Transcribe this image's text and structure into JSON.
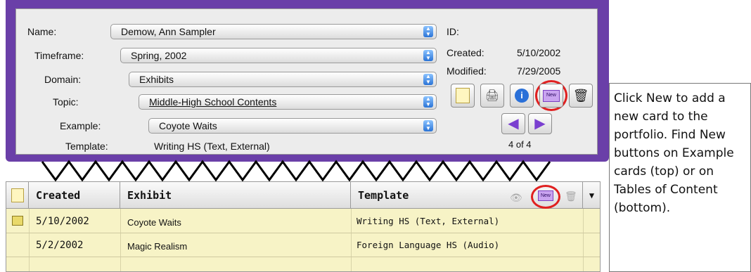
{
  "form": {
    "name_label": "Name:",
    "name_value": "Demow, Ann Sampler",
    "timeframe_label": "Timeframe:",
    "timeframe_value": "Spring, 2002",
    "domain_label": "Domain:",
    "domain_value": "Exhibits",
    "topic_label": "Topic:",
    "topic_value": "Middle-High School Contents",
    "example_label": "Example:",
    "example_value": "Coyote Waits",
    "template_label": "Template:",
    "template_value": "Writing HS (Text, External)"
  },
  "meta": {
    "id_label": "ID:",
    "created_label": "Created:",
    "created_value": "5/10/2002",
    "modified_label": "Modified:",
    "modified_value": "7/29/2005",
    "record_counter": "4 of 4"
  },
  "toolbar": {
    "new_label": "New"
  },
  "callout": {
    "text": "Click New to add a new card to the portfolio. Find New buttons on Example cards (top) or on Tables of Content (bottom)."
  },
  "table": {
    "headers": {
      "created": "Created",
      "exhibit": "Exhibit",
      "template": "Template"
    },
    "rows": [
      {
        "created": "5/10/2002",
        "exhibit": "Coyote Waits",
        "template": "Writing HS (Text, External)"
      },
      {
        "created": "5/2/2002",
        "exhibit": "Magic Realism",
        "template": "Foreign Language HS (Audio)"
      }
    ],
    "new_label": "New"
  },
  "colors": {
    "window_frame": "#6a3fa8",
    "highlight_circle": "#e02020",
    "table_background": "#f7f3c6"
  }
}
